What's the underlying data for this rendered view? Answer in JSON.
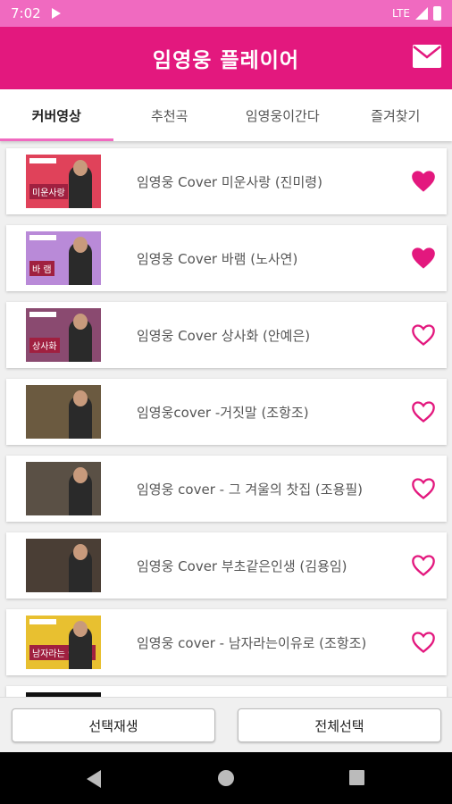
{
  "status_bar": {
    "time": "7:02",
    "network": "LTE"
  },
  "app_bar": {
    "title": "임영웅 플레이어"
  },
  "tabs": [
    {
      "label": "커버영상",
      "active": true
    },
    {
      "label": "추천곡",
      "active": false
    },
    {
      "label": "임영웅이간다",
      "active": false
    },
    {
      "label": "즐겨찾기",
      "active": false
    }
  ],
  "songs": [
    {
      "title": "임영웅 Cover 미운사랑 (진미령)",
      "favorite": true,
      "thumb_bg": "#e0425a",
      "thumb_badge": "미운사랑"
    },
    {
      "title": "임영웅 Cover 바램 (노사연)",
      "favorite": true,
      "thumb_bg": "#b98ad8",
      "thumb_badge": "바 램"
    },
    {
      "title": "임영웅 Cover 상사화 (안예은)",
      "favorite": false,
      "thumb_bg": "#8a4a70",
      "thumb_badge": "상사화"
    },
    {
      "title": "임영웅cover -거짓말 (조항조)",
      "favorite": false,
      "thumb_bg": "#6b5a40",
      "thumb_badge": ""
    },
    {
      "title": "임영웅 cover - 그 겨울의 찻집 (조용필)",
      "favorite": false,
      "thumb_bg": "#5a5045",
      "thumb_badge": ""
    },
    {
      "title": "임영웅 Cover 부초같은인생 (김용임)",
      "favorite": false,
      "thumb_bg": "#4a3e35",
      "thumb_badge": ""
    },
    {
      "title": "임영웅 cover - 남자라는이유로 (조항조)",
      "favorite": false,
      "thumb_bg": "#e8c030",
      "thumb_badge": "남자라는 이유로"
    }
  ],
  "buttons": {
    "play_selected": "선택재생",
    "select_all": "전체선택"
  },
  "colors": {
    "accent": "#e3187e",
    "status_bar": "#f06ac0",
    "heart": "#e3187e"
  }
}
